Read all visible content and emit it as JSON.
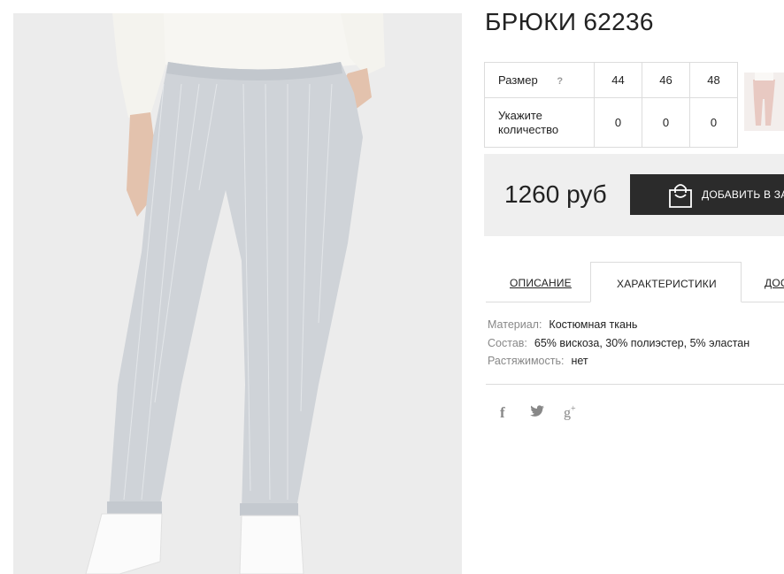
{
  "product": {
    "title": "БРЮКИ 62236",
    "main_image": "product-photo",
    "thumbnail": "product-thumbnail"
  },
  "sizes": {
    "label": "Размер",
    "help": "?",
    "values": [
      "44",
      "46",
      "48"
    ],
    "qty_label_line1": "Укажите",
    "qty_label_line2": "количество",
    "quantities": [
      "0",
      "0",
      "0"
    ]
  },
  "price": {
    "amount": "1260 руб",
    "cart_button": "ДОБАВИТЬ В ЗАКАЗ",
    "cart_icon": "shopping-bag-icon"
  },
  "tabs": [
    {
      "label": "ОПИСАНИЕ",
      "active": false
    },
    {
      "label": "ХАРАКТЕРИСТИКИ",
      "active": true
    },
    {
      "label": "ДОСТАВКА",
      "active": false
    }
  ],
  "characteristics": [
    {
      "key": "Материал:",
      "value": "Костюмная ткань"
    },
    {
      "key": "Состав:",
      "value": "65% вискоза, 30% полиэстер, 5% эластан"
    },
    {
      "key": "Растяжимость:",
      "value": "нет"
    }
  ],
  "social": {
    "facebook": "f",
    "twitter": "twitter-icon",
    "google": "g",
    "google_plus": "+"
  },
  "colors": {
    "button_bg": "#2b2b2b",
    "price_bg": "#efefef",
    "border": "#dcdcdc",
    "pants": "#cfd3d8"
  }
}
